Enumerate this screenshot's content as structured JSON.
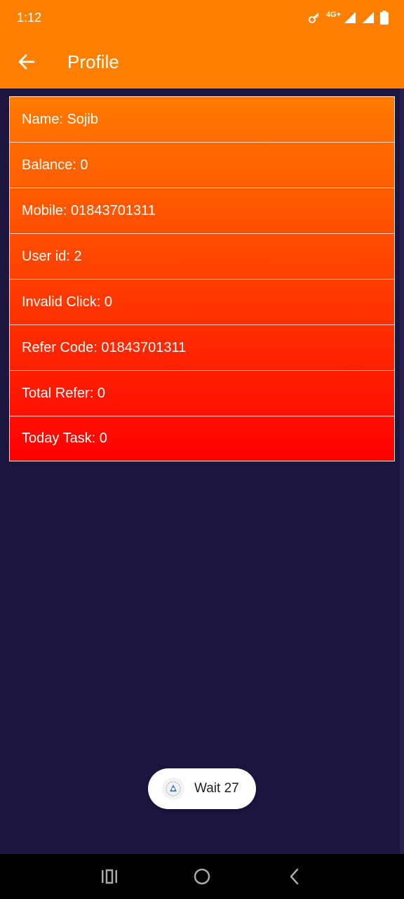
{
  "status_bar": {
    "time": "1:12",
    "network": "4G+",
    "icons": [
      "key-icon",
      "signal-icon",
      "signal-icon",
      "battery-icon"
    ]
  },
  "app_bar": {
    "title": "Profile",
    "back_icon": "arrow-left-icon"
  },
  "profile": {
    "rows": [
      {
        "label": "Name: Sojib"
      },
      {
        "label": "Balance: 0"
      },
      {
        "label": "Mobile: 01843701311"
      },
      {
        "label": "User id: 2"
      },
      {
        "label": "Invalid Click: 0"
      },
      {
        "label": "Refer Code: 01843701311"
      },
      {
        "label": "Total Refer: 0"
      },
      {
        "label": "Today Task: 0"
      }
    ]
  },
  "toast": {
    "text": "Wait 27",
    "icon": "app-logo-icon"
  },
  "nav_bar": {
    "icons": [
      "recents-icon",
      "home-icon",
      "back-icon"
    ]
  },
  "colors": {
    "accent": "#ff7f00",
    "background": "#1b1540",
    "gradient_top": "#ff7a00",
    "gradient_bottom": "#ff0000"
  }
}
